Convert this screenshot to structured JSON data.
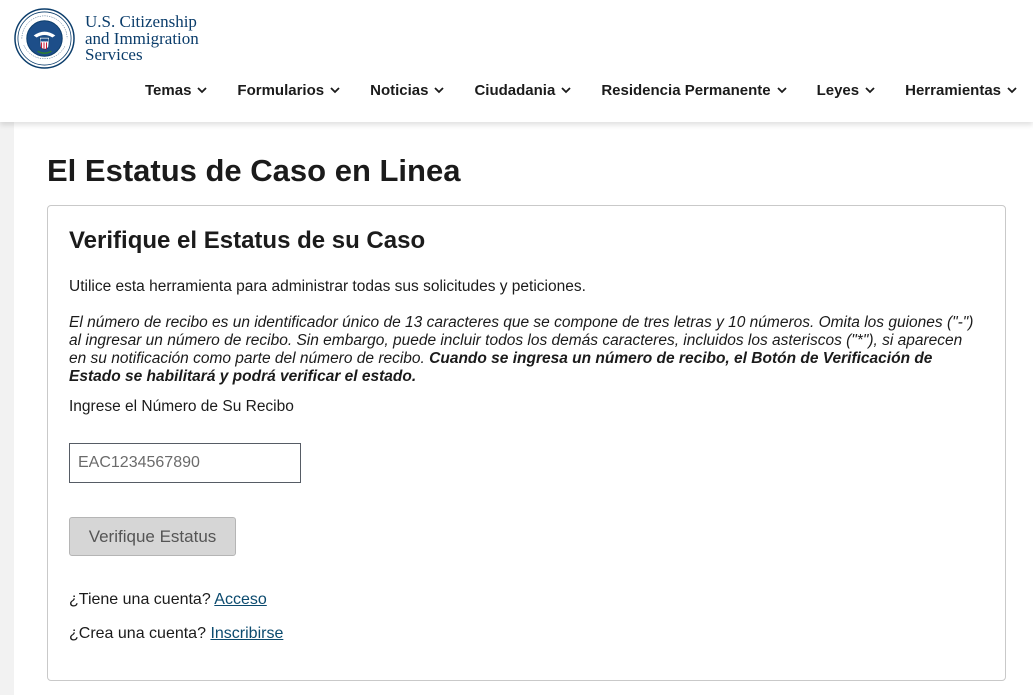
{
  "header": {
    "logo_lines": [
      "U.S. Citizenship",
      "and Immigration",
      "Services"
    ],
    "seal_alt": "dhs-seal-icon",
    "nav": [
      {
        "label": "Temas"
      },
      {
        "label": "Formularios"
      },
      {
        "label": "Noticias"
      },
      {
        "label": "Ciudadania"
      },
      {
        "label": "Residencia Permanente"
      },
      {
        "label": "Leyes"
      },
      {
        "label": "Herramientas"
      }
    ]
  },
  "main": {
    "page_title": "El Estatus de Caso en Linea",
    "card": {
      "title": "Verifique el Estatus de su Caso",
      "intro": "Utilice esta herramienta para administrar todas sus solicitudes y peticiones.",
      "info_italic": "El número de recibo es un identificador único de 13 caracteres que se compone de tres letras y 10 números. Omita los guiones (\"-\") al ingresar un número de recibo. Sin embargo, puede incluir todos los demás caracteres, incluidos los asteriscos (\"*\"), si aparecen en su notificación como parte del número de recibo.",
      "info_bold": "Cuando se ingresa un número de recibo, el Botón de Verificación de Estado se habilitará y podrá verificar el estado.",
      "receipt_label": "Ingrese el Número de Su Recibo",
      "receipt_placeholder": "EAC1234567890",
      "verify_label": "Verifique Estatus",
      "has_account_text": "¿Tiene una cuenta?",
      "login_link": "Acceso",
      "create_account_text": "¿Crea una cuenta?",
      "signup_link": "Inscribirse"
    }
  },
  "colors": {
    "brand_blue": "#0b3d6b",
    "link": "#0b4a6e",
    "button_disabled": "#d6d6d6"
  }
}
